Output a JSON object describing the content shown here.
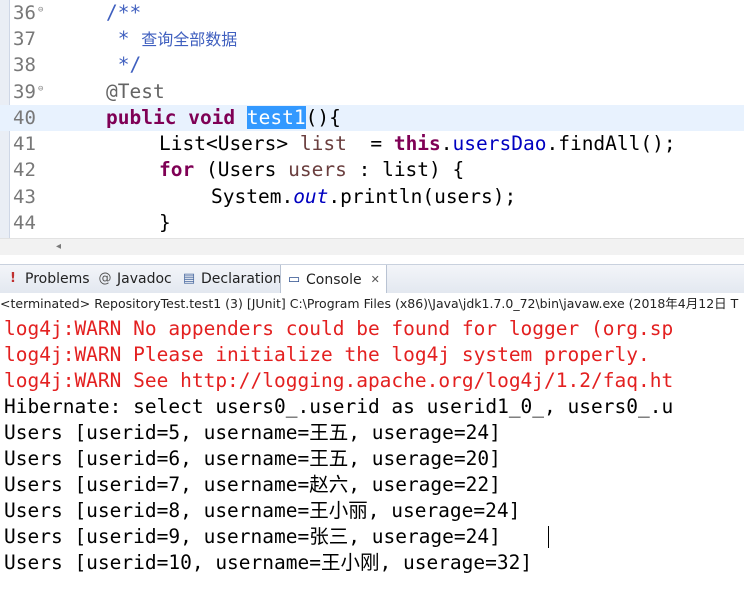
{
  "editor": {
    "lines": [
      {
        "num": "36",
        "fold": "⊖",
        "text": "/**"
      },
      {
        "num": "37",
        "fold": "",
        "text_prefix": " * ",
        "text_cjk": "查询全部数据"
      },
      {
        "num": "38",
        "fold": "",
        "text": " */"
      },
      {
        "num": "39",
        "fold": "⊖",
        "text": "@Test"
      },
      {
        "num": "40",
        "fold": "",
        "kw1": "public",
        "kw2": "void",
        "method": "test1",
        "tail": "(){"
      },
      {
        "num": "41",
        "fold": "",
        "type": "List<Users>",
        "var": "list",
        "eq": "  = ",
        "kw": "this",
        "dot": ".",
        "field": "usersDao",
        "call": ".findAll();"
      },
      {
        "num": "42",
        "fold": "",
        "kw": "for",
        "open": " (Users ",
        "var": "users",
        "rest": " : list) {"
      },
      {
        "num": "43",
        "fold": "",
        "pre": "System.",
        "static_field": "out",
        "post": ".println(users);"
      },
      {
        "num": "44",
        "fold": "",
        "text": "}"
      }
    ],
    "scroll_arrow": "◂"
  },
  "tabs": [
    {
      "label": "Problems",
      "icon": "!"
    },
    {
      "label": "Javadoc",
      "icon": "@"
    },
    {
      "label": "Declaration",
      "icon": "▤"
    },
    {
      "label": "Console",
      "icon": "▭",
      "close": "✕"
    }
  ],
  "console": {
    "header": "<terminated> RepositoryTest.test1 (3) [JUnit] C:\\Program Files (x86)\\Java\\jdk1.7.0_72\\bin\\javaw.exe (2018年4月12日 T",
    "lines": [
      "log4j:WARN No appenders could be found for logger (org.sp",
      "log4j:WARN Please initialize the log4j system properly.",
      "log4j:WARN See http://logging.apache.org/log4j/1.2/faq.ht",
      "Hibernate: select users0_.userid as userid1_0_, users0_.u",
      "Users [userid=5, username=王五, userage=24]",
      "Users [userid=6, username=王五, userage=20]",
      "Users [userid=7, username=赵六, userage=22]",
      "Users [userid=8, username=王小丽, userage=24]",
      "Users [userid=9, username=张三, userage=24]",
      "Users [userid=10, username=王小刚, userage=32]"
    ]
  },
  "colors": {
    "keyword": "#7f0055",
    "comment": "#3f5fbf",
    "field": "#0000c0",
    "warn": "#e32020",
    "selection": "#3399ff",
    "current_line": "#e8f2fe"
  }
}
